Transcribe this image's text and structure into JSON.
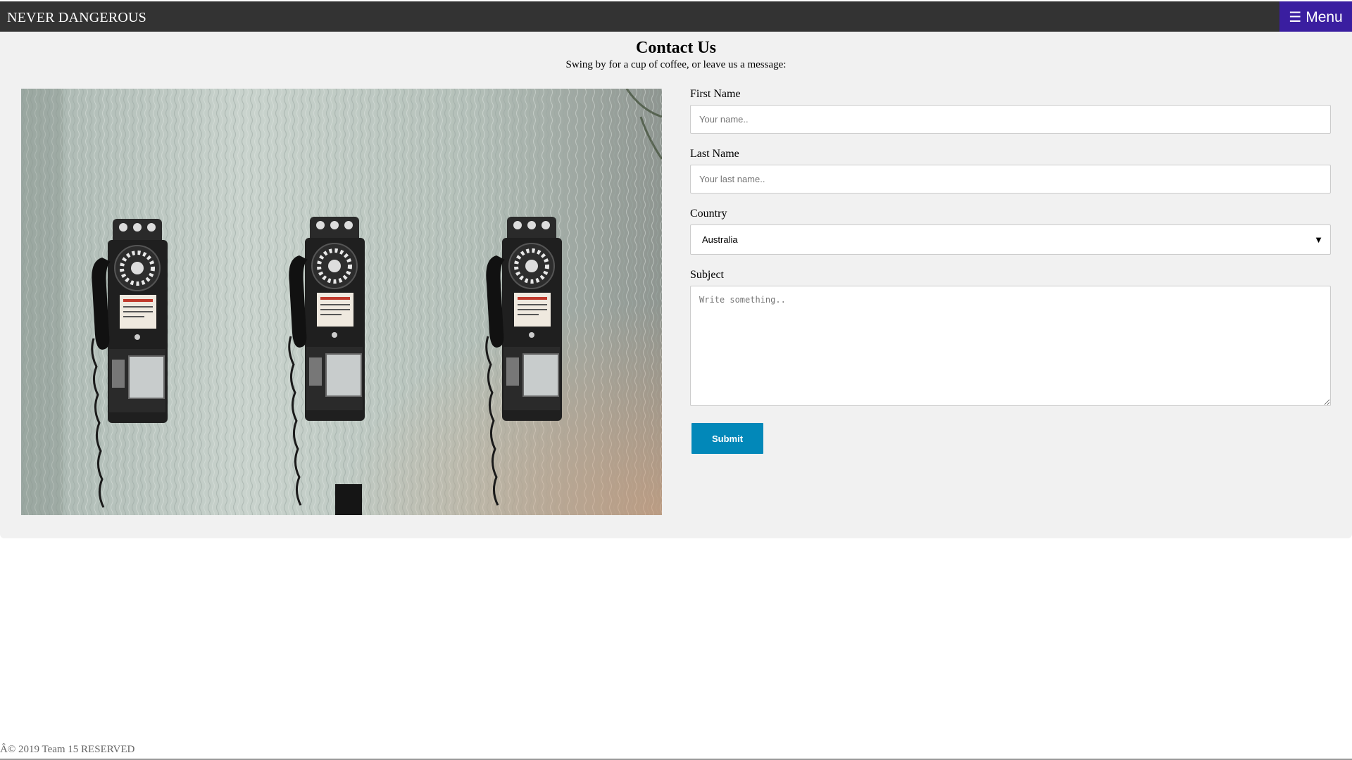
{
  "header": {
    "brand": "NEVER DANGEROUS",
    "menu_icon": "☰",
    "menu_label": "Menu"
  },
  "contact": {
    "title": "Contact Us",
    "subtitle": "Swing by for a cup of coffee, or leave us a message:"
  },
  "form": {
    "first_name_label": "First Name",
    "first_name_placeholder": "Your name..",
    "last_name_label": "Last Name",
    "last_name_placeholder": "Your last name..",
    "country_label": "Country",
    "country_value": "Australia",
    "country_arrow": "▼",
    "subject_label": "Subject",
    "subject_placeholder": "Write something..",
    "submit_label": "Submit"
  },
  "footer": {
    "text": "Â© 2019 Team 15 RESERVED"
  },
  "colors": {
    "topbar": "#333333",
    "menu_button": "#3a1ea0",
    "panel": "#f1f1f1",
    "submit": "#0288b9"
  },
  "image": {
    "icon": "payphones-photo"
  }
}
